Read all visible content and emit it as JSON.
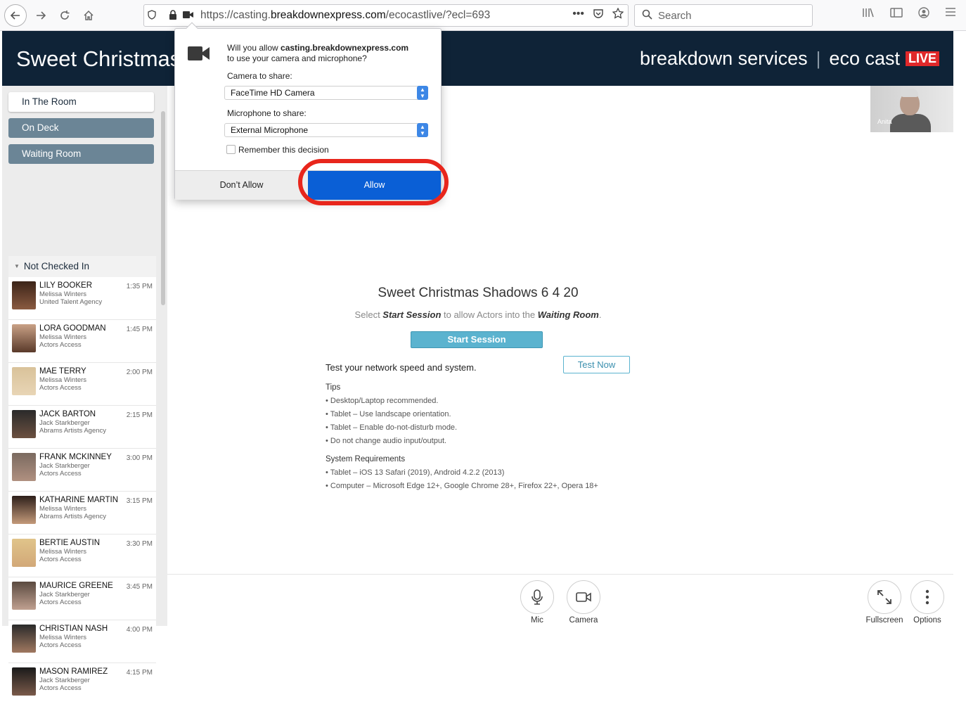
{
  "browser": {
    "url_prefix": "https://casting.",
    "url_domain": "breakdownexpress.com",
    "url_suffix": "/ecocastlive/?ecl=693",
    "search_placeholder": "Search"
  },
  "header": {
    "title": "Sweet Christmas",
    "brand_left": "breakdown services",
    "brand_right": "eco cast",
    "brand_live": "LIVE"
  },
  "sidebar": {
    "rooms": [
      "In The Room",
      "On Deck",
      "Waiting Room"
    ],
    "list_title": "Not Checked In",
    "actors": [
      {
        "name": "LILY BOOKER",
        "agent": "Melissa Winters",
        "agency": "United Talent Agency",
        "time": "1:35 PM"
      },
      {
        "name": "LORA GOODMAN",
        "agent": "Melissa Winters",
        "agency": "Actors Access",
        "time": "1:45 PM"
      },
      {
        "name": "MAE TERRY",
        "agent": "Melissa Winters",
        "agency": "Actors Access",
        "time": "2:00 PM"
      },
      {
        "name": "JACK BARTON",
        "agent": "Jack Starkberger",
        "agency": "Abrams Artists Agency",
        "time": "2:15 PM"
      },
      {
        "name": "FRANK MCKINNEY",
        "agent": "Jack Starkberger",
        "agency": "Actors Access",
        "time": "3:00 PM"
      },
      {
        "name": "KATHARINE MARTIN",
        "agent": "Melissa Winters",
        "agency": "Abrams Artists Agency",
        "time": "3:15 PM"
      },
      {
        "name": "BERTIE AUSTIN",
        "agent": "Melissa Winters",
        "agency": "Actors Access",
        "time": "3:30 PM"
      },
      {
        "name": "MAURICE GREENE",
        "agent": "Jack Starkberger",
        "agency": "Actors Access",
        "time": "3:45 PM"
      },
      {
        "name": "CHRISTIAN NASH",
        "agent": "Melissa Winters",
        "agency": "Actors Access",
        "time": "4:00 PM"
      },
      {
        "name": "MASON RAMIREZ",
        "agent": "Jack Starkberger",
        "agency": "Actors Access",
        "time": "4:15 PM"
      }
    ]
  },
  "main": {
    "session_title": "Sweet Christmas Shadows 6 4 20",
    "sub_pre": "Select ",
    "sub_b1": "Start Session",
    "sub_mid": " to allow Actors into the ",
    "sub_b2": "Waiting Room",
    "sub_end": ".",
    "start_label": "Start Session",
    "network_label": "Test your network speed and system.",
    "test_label": "Test Now",
    "tips_title": "Tips",
    "tips": [
      "Desktop/Laptop recommended.",
      "Tablet – Use landscape orientation.",
      "Tablet – Enable do-not-disturb mode.",
      "Do not change audio input/output."
    ],
    "req_title": "System Requirements",
    "requirements": [
      "Tablet – iOS 13 Safari (2019), Android 4.2.2 (2013)",
      "Computer – Microsoft Edge 12+, Google Chrome 28+, Firefox 22+, Opera 18+"
    ],
    "video_name": "Anita"
  },
  "controls": {
    "mic": "Mic",
    "camera": "Camera",
    "fullscreen": "Fullscreen",
    "options": "Options"
  },
  "permission": {
    "q_pre": "Will you allow ",
    "q_host": "casting.breakdownexpress.com",
    "q_post": "to use your camera and microphone?",
    "camera_label": "Camera to share:",
    "camera_value": "FaceTime HD Camera",
    "mic_label": "Microphone to share:",
    "mic_value": "External Microphone",
    "remember": "Remember this decision",
    "deny": "Don’t Allow",
    "allow": "Allow"
  },
  "colors": {
    "header_bg": "#0f2337",
    "accent": "#5bb3cf",
    "allow": "#0a5fd6",
    "highlight": "#e8261c",
    "live": "#e0282a"
  }
}
